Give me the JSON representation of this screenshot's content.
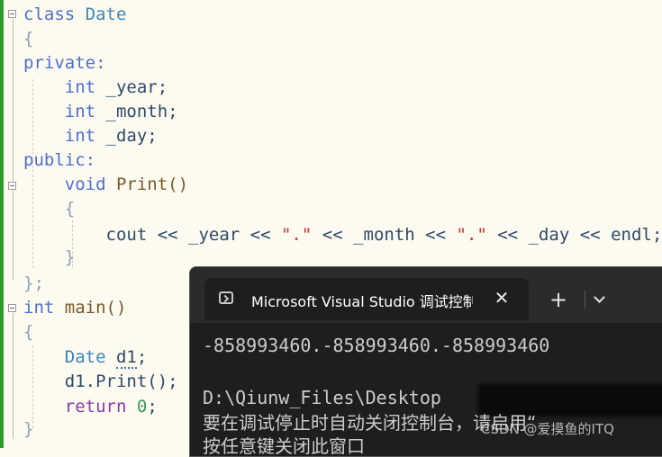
{
  "editor": {
    "lines": [
      [
        "class ",
        "Date"
      ],
      [
        "{"
      ],
      [
        "private:"
      ],
      [
        "    ",
        "int",
        " _year;"
      ],
      [
        "    ",
        "int",
        " _month;"
      ],
      [
        "    ",
        "int",
        " _day;"
      ],
      [
        "public:"
      ],
      [
        "    ",
        "void",
        " Print()"
      ],
      [
        "    {"
      ],
      [
        "        cout << _year << ",
        "\".\"",
        " << _month << ",
        "\".\"",
        " << _day << endl;"
      ],
      [
        "    }"
      ],
      [
        "};"
      ],
      [
        "int",
        " main()"
      ],
      [
        "{"
      ],
      [
        "    Date ",
        "d1",
        ";"
      ],
      [
        "    d1.Print();"
      ],
      [
        "    ",
        "return",
        " ",
        "0",
        ";"
      ],
      [
        "}"
      ]
    ]
  },
  "terminal": {
    "tab_title": "Microsoft Visual Studio 调试控制台",
    "close_glyph": "✕",
    "new_tab_glyph": "+",
    "output": [
      "-858993460.-858993460.-858993460",
      "",
      "D:\\Qiunw_Files\\Desktop",
      "要在调试停止时自动关闭控制台，请启用“",
      "按任意键关闭此窗口"
    ]
  },
  "watermark": "CSDN @爱摸鱼的ITQ"
}
